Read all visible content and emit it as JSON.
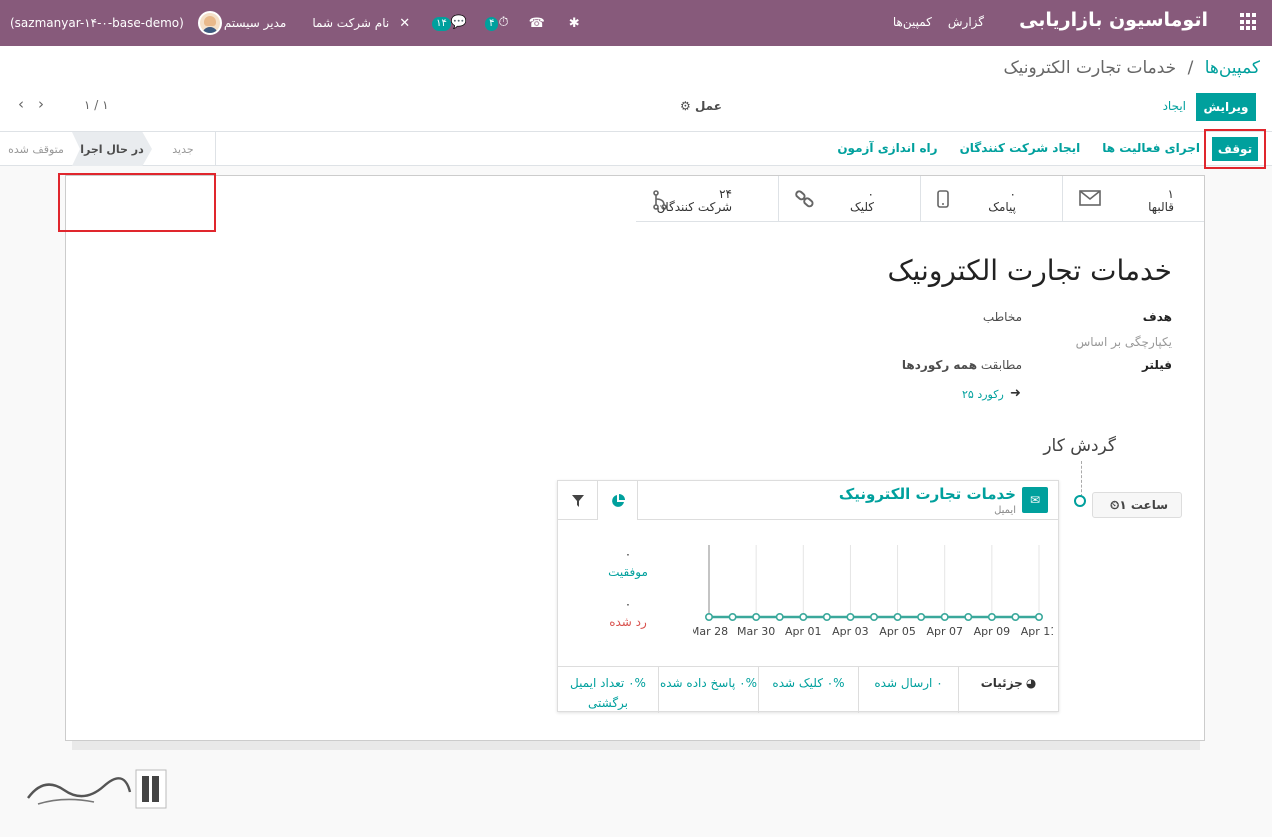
{
  "navbar": {
    "brand": "اتوماسیون بازاریابی",
    "menu": [
      "کمپین‌ها",
      "گزارش"
    ],
    "company": "نام شرکت شما",
    "user": "مدیر سیستم",
    "db": "(sazmanyar-۱۴-۰-base-demo)",
    "badge_activities": "۴",
    "badge_messages": "۱۴"
  },
  "breadcrumb": {
    "parent": "کمپین‌ها",
    "separator": "/",
    "current": "خدمات تجارت الکترونیک"
  },
  "toolbar": {
    "edit": "ویرایش",
    "create": "ایجاد",
    "action": "عمل",
    "pager": "۱ / ۱"
  },
  "statusbar": {
    "stop": "توقف",
    "actions": [
      "راه اندازی آزمون",
      "ایجاد شرکت کنندگان",
      "اجرای فعالیت ها"
    ],
    "stages": [
      "متوقف شده",
      "در حال اجرا",
      "جدید"
    ]
  },
  "stats": [
    {
      "num": "۱",
      "label": "قالبها",
      "icon": "envelope-icon"
    },
    {
      "num": "۰",
      "label": "پیامک",
      "icon": "mobile-icon"
    },
    {
      "num": "۰",
      "label": "کلیک",
      "icon": "link-icon"
    },
    {
      "num": "۲۴",
      "label": "شرکت کنندگان",
      "icon": "branch-icon"
    }
  ],
  "record": {
    "title": "خدمات تجارت الکترونیک",
    "target_label": "هدف",
    "target_value": "مخاطب",
    "unique_label": "یکپارچگی بر اساس",
    "filter_label": "فیلتر",
    "filter_prefix": "مطابقت",
    "filter_value": "همه رکوردها",
    "records_link": "۲۵ رکورد"
  },
  "workflow": {
    "title": "گردش کار",
    "time_trigger": "۱ ساعت",
    "activity_title": "خدمات تجارت الکترونیک",
    "activity_type": "ایمیل",
    "success_count": "۰",
    "success_label": "موفقیت",
    "rejected_count": "۰",
    "rejected_label": "رد شده"
  },
  "footer": [
    {
      "text": "جزئیات"
    },
    {
      "text": "۰ ارسال شده"
    },
    {
      "text": "۰% کلیک شده"
    },
    {
      "text": "۰% پاسخ داده شده"
    },
    {
      "text": "۰% تعداد ایمیل برگشتی"
    }
  ],
  "chart_data": {
    "type": "line",
    "categories": [
      "Mar 28",
      "Mar 29",
      "Mar 30",
      "Mar 31",
      "Apr 01",
      "Apr 02",
      "Apr 03",
      "Apr 04",
      "Apr 05",
      "Apr 06",
      "Apr 07",
      "Apr 08",
      "Apr 09",
      "Apr 10",
      "Apr 11"
    ],
    "tick_labels": [
      "Mar 28",
      "Mar 30",
      "Apr 01",
      "Apr 03",
      "Apr 05",
      "Apr 07",
      "Apr 09",
      "Apr 11"
    ],
    "series": [
      {
        "color": "#3aa89b",
        "values": [
          0,
          0,
          0,
          0,
          0,
          0,
          0,
          0,
          0,
          0,
          0,
          0,
          0,
          0,
          0
        ]
      }
    ],
    "grid": true
  },
  "colors": {
    "navbar": "#875a7b",
    "primary": "#00a09d",
    "danger": "#d9534f",
    "highlight": "#e0262d"
  }
}
